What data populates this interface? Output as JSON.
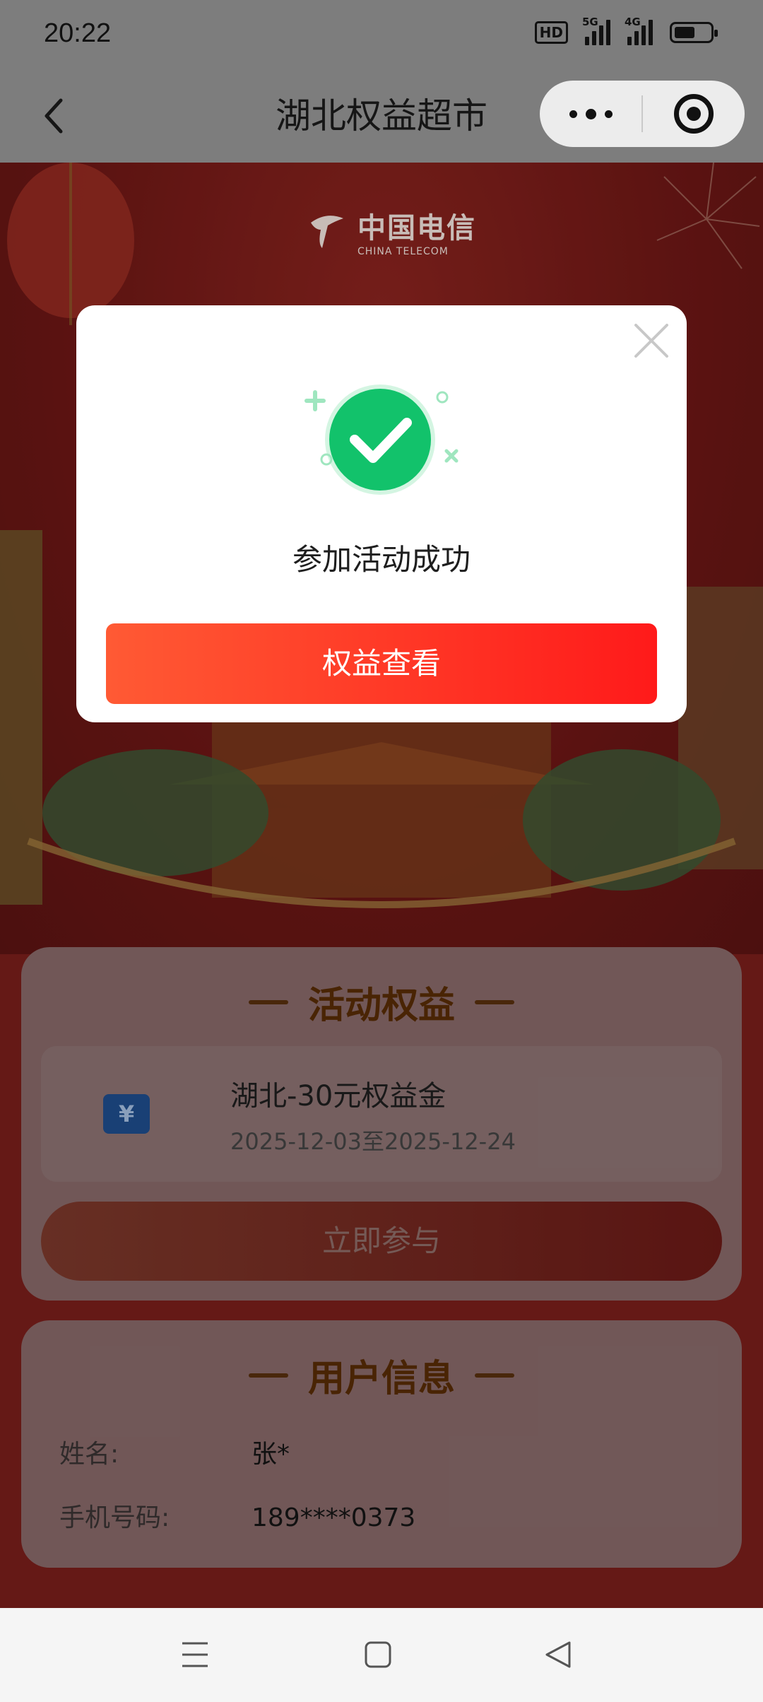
{
  "status_bar": {
    "time": "20:22",
    "hd_label": "HD",
    "sig1_tag": "5G",
    "sig2_tag": "4G"
  },
  "title_bar": {
    "title": "湖北权益超市"
  },
  "logo": {
    "cn": "中国电信",
    "en": "CHINA TELECOM"
  },
  "activity_card": {
    "header": "活动权益",
    "benefit_name": "湖北-30元权益金",
    "benefit_period": "2025-12-03至2025-12-24",
    "coupon_symbol": "¥",
    "join_label": "立即参与"
  },
  "user_card": {
    "header": "用户信息",
    "name_label": "姓名:",
    "name_value": "张*",
    "phone_label": "手机号码:",
    "phone_value": "189****0373"
  },
  "modal": {
    "message": "参加活动成功",
    "button_label": "权益查看"
  },
  "colors": {
    "primary_red": "#ff1a1a",
    "success_green": "#12c26b"
  }
}
